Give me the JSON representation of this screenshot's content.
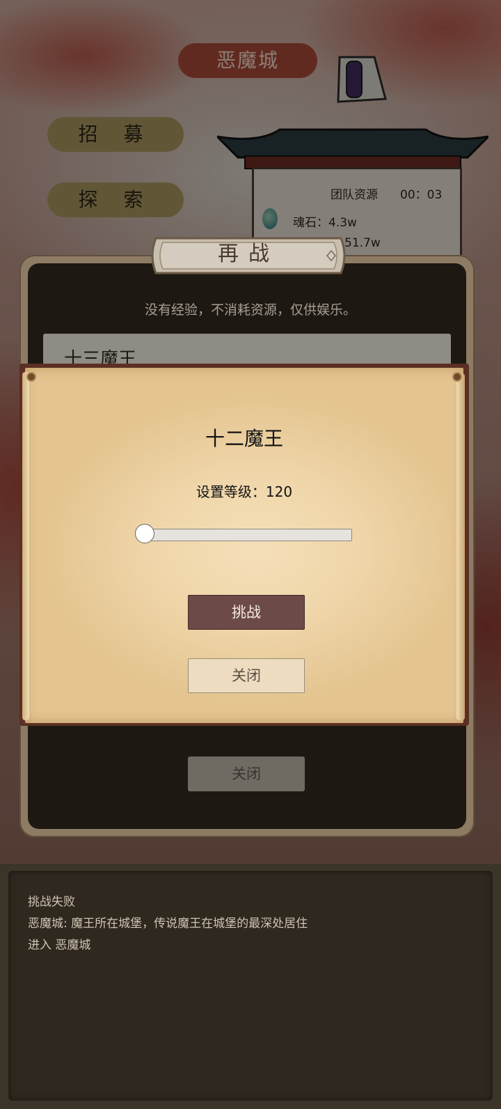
{
  "scene": {
    "city_title": "恶魔城",
    "side_buttons": [
      "招 募",
      "探 索"
    ],
    "board": {
      "title": "团队资源",
      "timer": "00：03",
      "resource_line": "魂石：4.3w",
      "resource_line2": "51.7w"
    }
  },
  "replay_dialog": {
    "title": "再战",
    "subtitle": "没有经验，不消耗资源，仅供娱乐。",
    "list_items": [
      "十三魔王"
    ],
    "close_label": "关闭"
  },
  "level_popup": {
    "title": "十二魔王",
    "level_label": "设置等级：120",
    "slider_fill_fraction": 0.0,
    "challenge_label": "挑战",
    "close_label": "关闭"
  },
  "log": {
    "lines": [
      "挑战失败",
      "恶魔城: 魔王所在城堡，传说魔王在城堡的最深处居住",
      "进入 恶魔城"
    ]
  },
  "colors": {
    "challenge_button": "#6c4a48",
    "parchment": "#f0d7ab",
    "dialog_background": "#1d1912"
  }
}
